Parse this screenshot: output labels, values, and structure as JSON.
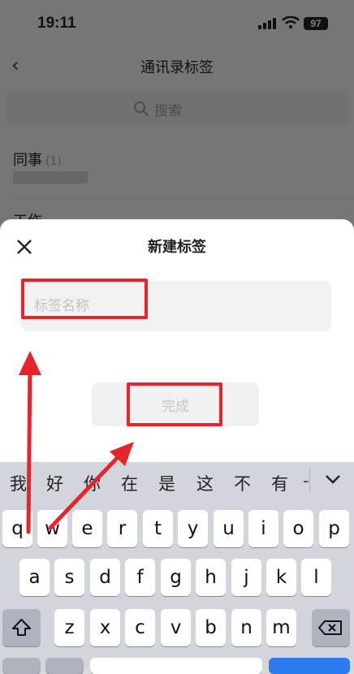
{
  "status": {
    "time": "19:11",
    "battery": "97"
  },
  "nav": {
    "back_icon": "chevron-left-icon",
    "title": "通讯录标签"
  },
  "search": {
    "label": "搜索"
  },
  "list": [
    {
      "name": "同事",
      "count": "(1)"
    },
    {
      "name": "工作"
    }
  ],
  "sheet": {
    "title": "新建标签",
    "name_placeholder": "标签名称",
    "done_label": "完成"
  },
  "keyboard": {
    "candidates": [
      "我",
      "好",
      "你",
      "在",
      "是",
      "这",
      "不",
      "有",
      "-"
    ],
    "row1": [
      "q",
      "w",
      "e",
      "r",
      "t",
      "y",
      "u",
      "i",
      "o",
      "p"
    ],
    "row2": [
      "a",
      "s",
      "d",
      "f",
      "g",
      "h",
      "j",
      "k",
      "l"
    ],
    "row3": [
      "z",
      "x",
      "c",
      "v",
      "b",
      "n",
      "m"
    ]
  },
  "colors": {
    "annotation_red": "#e8242a",
    "accent_blue": "#2b7bf0"
  }
}
